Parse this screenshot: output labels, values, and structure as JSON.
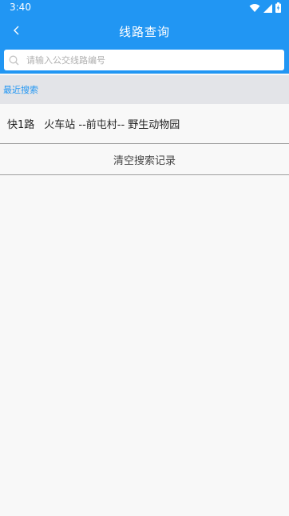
{
  "status_bar": {
    "time": "3:40",
    "icons": [
      "wifi-icon",
      "signal-icon",
      "battery-charging-icon"
    ]
  },
  "app_bar": {
    "back_icon": "chevron-left-icon",
    "title": "线路查询"
  },
  "search": {
    "icon": "search-icon",
    "placeholder": "请输入公交线路编号",
    "value": ""
  },
  "recent": {
    "header": "最近搜索",
    "items": [
      {
        "route": "快1路",
        "stops": "火车站 --前屯村-- 野生动物园"
      }
    ],
    "clear_label": "清空搜索记录"
  },
  "colors": {
    "primary": "#2196f3",
    "background": "#f8f8f8",
    "section_header_bg": "#e3e4e8",
    "divider": "#9e9e9e"
  }
}
